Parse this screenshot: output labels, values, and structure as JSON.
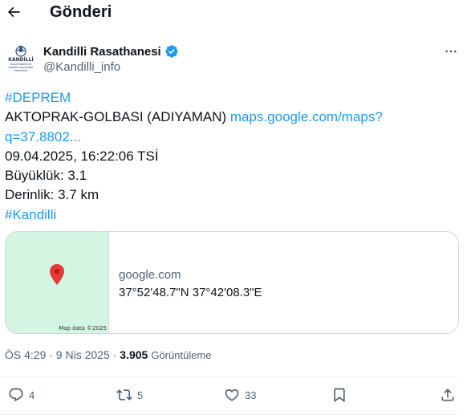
{
  "header": {
    "title": "Gönderi",
    "back_icon": "arrow-left-icon"
  },
  "author": {
    "name": "Kandilli Rasathanesi",
    "handle": "@Kandilli_info",
    "verified": true,
    "avatar_icon": "kandilli-logo-icon",
    "logo_text": [
      "KANDİLLİ",
      "RASATHANESİ VE",
      "DEPREM ARAŞTIRMA",
      "ENSTİTÜSÜ"
    ]
  },
  "tweet": {
    "hashtag_deprem": "#DEPREM",
    "location": "AKTOPRAK-GOLBASI (ADIYAMAN)",
    "map_link_part1": "maps.google.com/maps?",
    "map_link_part2": "q=37.8802...",
    "datetime": "09.04.2025, 16:22:06 TSİ",
    "magnitude": "Büyüklük: 3.1",
    "depth": "Derinlik: 3.7 km",
    "hashtag_kandilli": "#Kandilli"
  },
  "card": {
    "domain": "google.com",
    "coords": "37°52'48.7\"N 37°42'08.3\"E",
    "map_credit": "Map data ©2025"
  },
  "meta": {
    "time": "ÖS 4:29 · 9 Nis 2025 ·",
    "views_count": "3.905",
    "views_label": "Görüntüleme"
  },
  "actions": {
    "replies": "4",
    "reposts": "5",
    "likes": "33"
  },
  "colors": {
    "accent": "#1d9bf0",
    "text": "#0f1419",
    "muted": "#536471",
    "map_bg": "#d5f5e3",
    "pin": "#e53935"
  }
}
